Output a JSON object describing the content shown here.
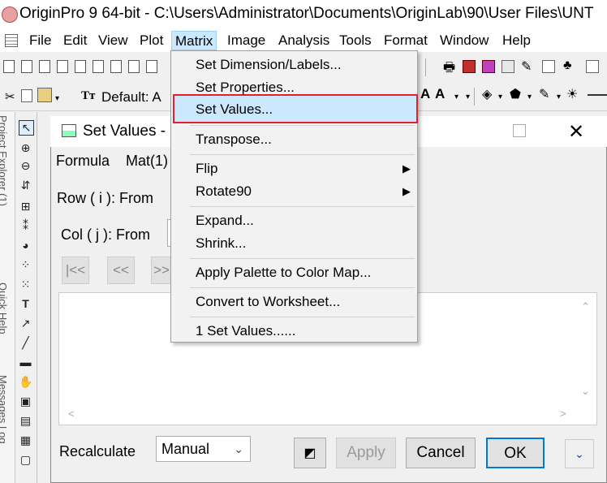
{
  "app": {
    "title": "OriginPro 9 64-bit - C:\\Users\\Administrator\\Documents\\OriginLab\\90\\User Files\\UNT"
  },
  "menubar": {
    "items": [
      "File",
      "Edit",
      "View",
      "Plot",
      "Matrix",
      "Image",
      "Analysis",
      "Tools",
      "Format",
      "Window",
      "Help"
    ],
    "active": "Matrix"
  },
  "toolbar": {
    "font_label": "Default: A"
  },
  "left_panel": {
    "project_explorer": "Project Explorer (1)",
    "quick_help": "Quick Help",
    "messages_log": "Messages Log"
  },
  "dialog": {
    "title": "Set Values -",
    "menu": [
      "Formula",
      "Mat(1)"
    ],
    "row_label": "Row ( i ):  From",
    "col_label": "Col  ( j ):  From",
    "nav_buttons": [
      "|<<",
      "<<",
      ">>"
    ],
    "recalculate_label": "Recalculate",
    "recalculate_value": "Manual",
    "apply_label": "Apply",
    "cancel_label": "Cancel",
    "ok_label": "OK",
    "more_label": "⌄"
  },
  "matrix_menu": {
    "items": [
      "Set Dimension/Labels...",
      "Set Properties...",
      "Set Values...",
      "Transpose...",
      "Flip",
      "Rotate90",
      "Expand...",
      "Shrink...",
      "Apply Palette to Color Map...",
      "Convert to Worksheet...",
      "1 Set Values......"
    ],
    "highlighted": "Set Values...",
    "highlight_border_color": "#e0202a"
  }
}
